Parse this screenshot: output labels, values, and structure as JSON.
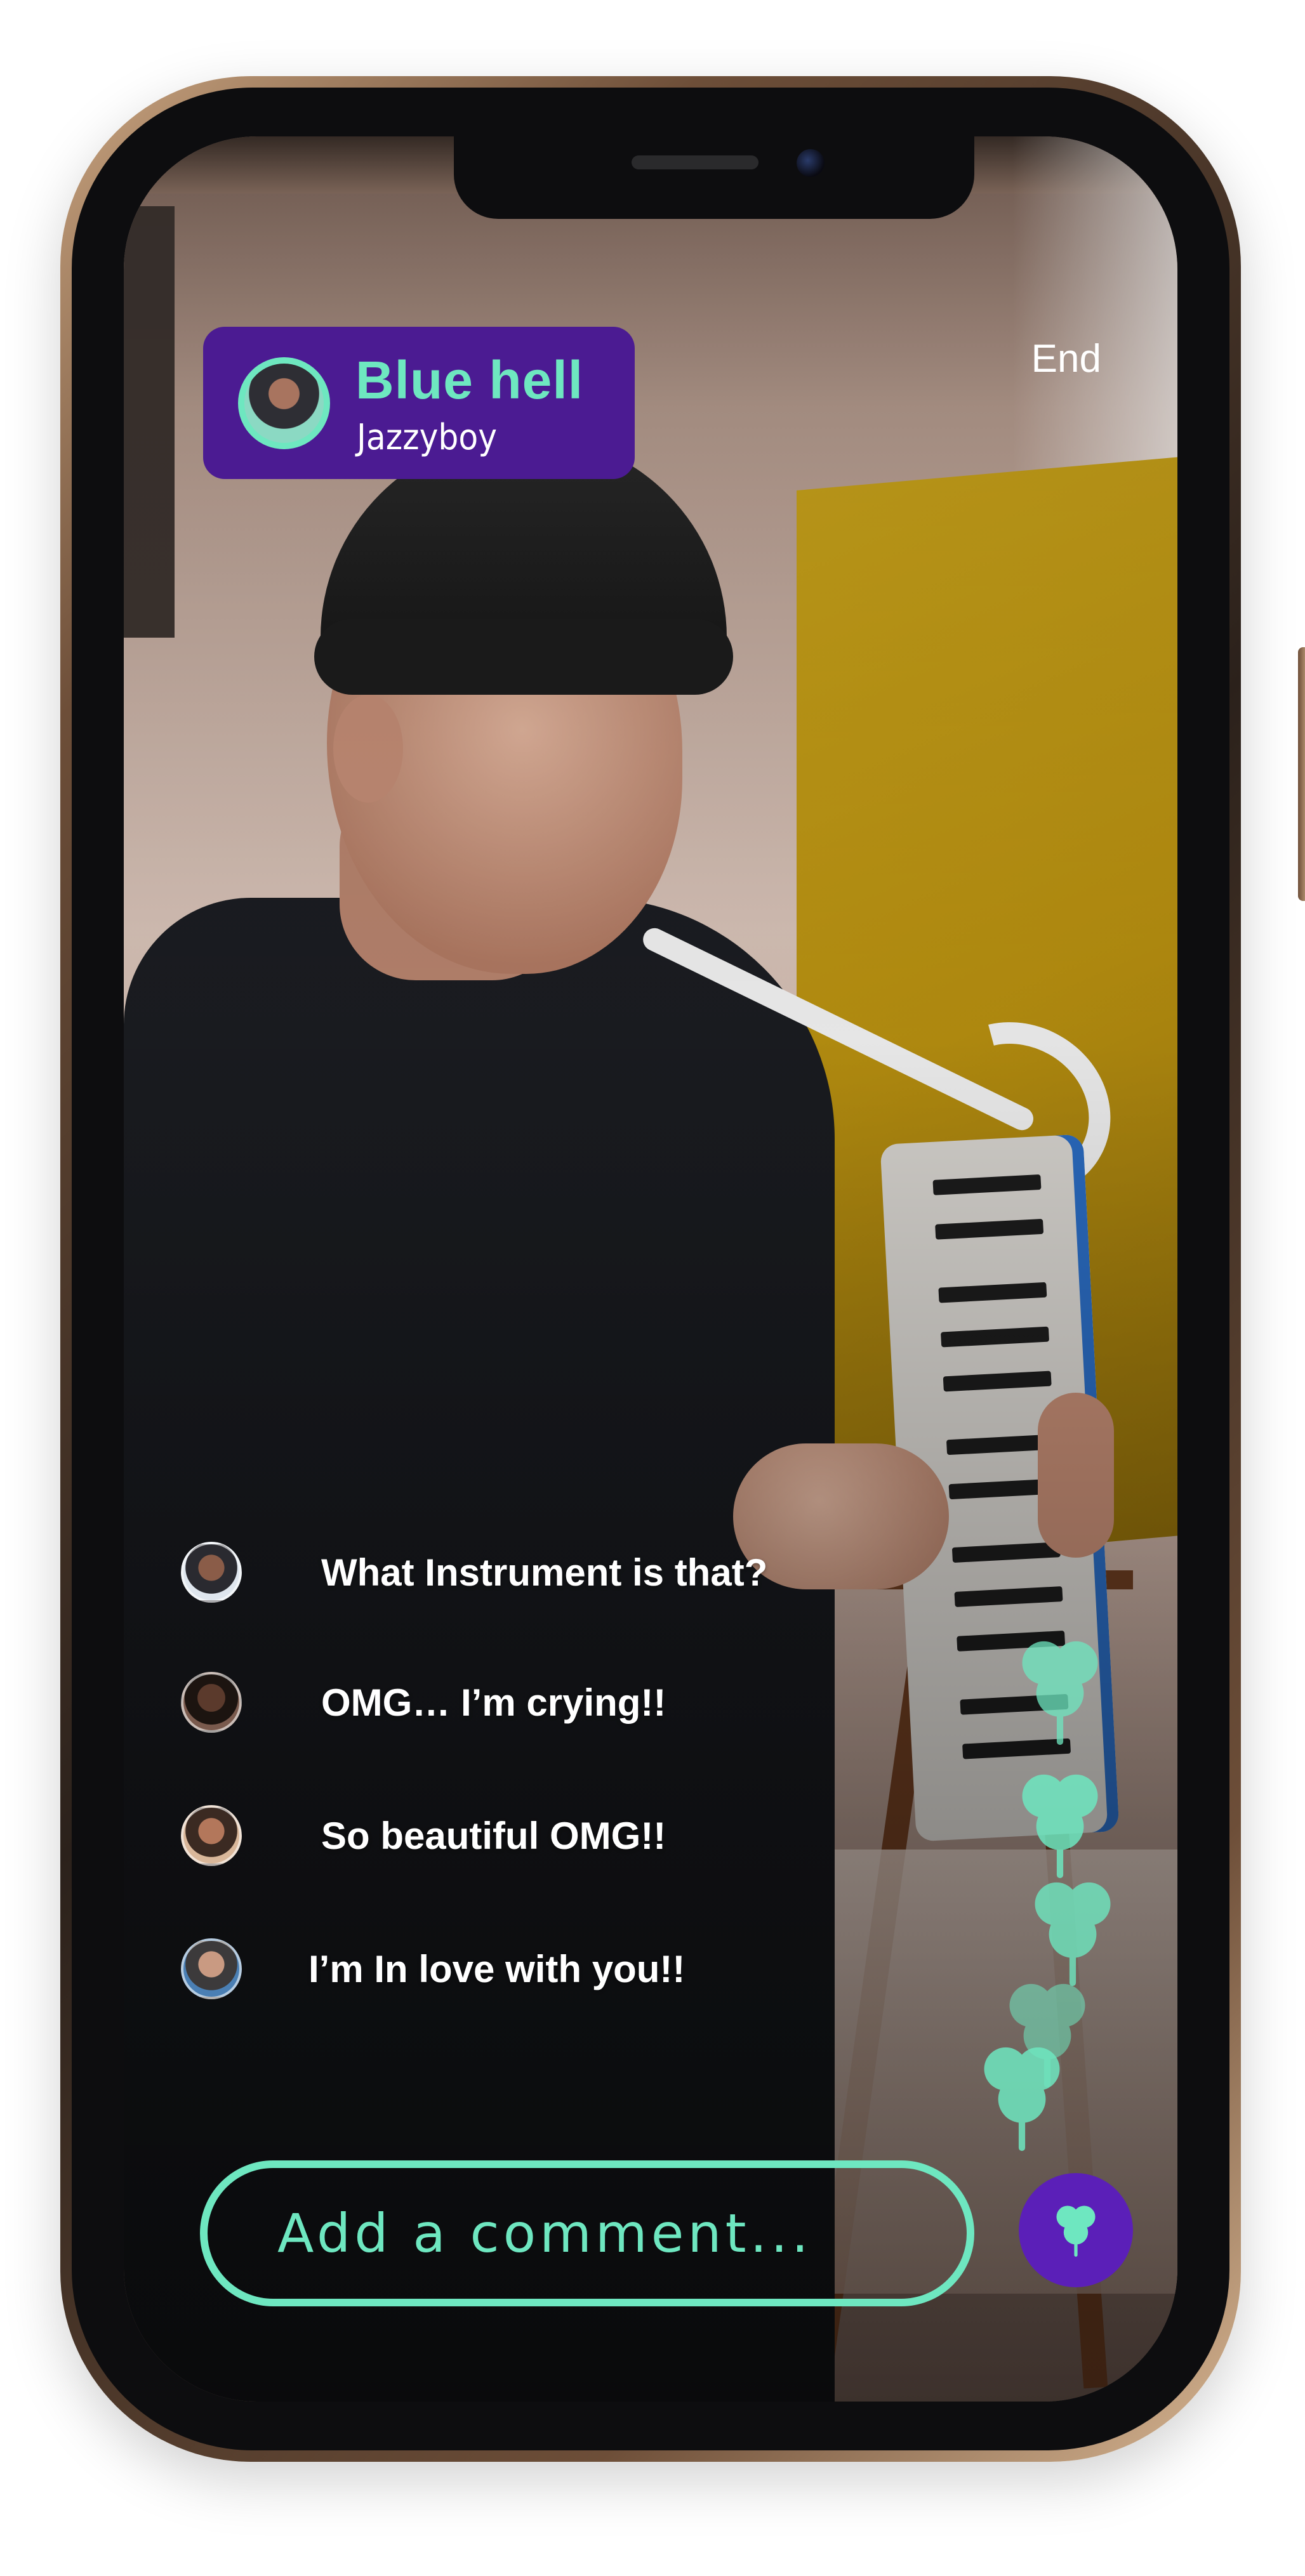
{
  "header": {
    "title": "Blue hell",
    "subtitle": "Jazzyboy",
    "end_label": "End"
  },
  "comments": [
    {
      "avatar": "user-avatar-1",
      "text": "What Instrument is that?"
    },
    {
      "avatar": "user-avatar-2",
      "text": "OMG… I’m crying!!"
    },
    {
      "avatar": "user-avatar-3",
      "text": "So beautiful OMG!!"
    },
    {
      "avatar": "user-avatar-4",
      "text": "I’m In love with you!!"
    }
  ],
  "composer": {
    "placeholder": "Add a comment...",
    "send_icon": "clover-icon"
  },
  "reactions": {
    "icon": "clover-icon",
    "count": 5
  },
  "colors": {
    "accent": "#6ee7c0",
    "primary": "#4b1b92",
    "send_button": "#5b1fb8",
    "text": "#ffffff"
  }
}
